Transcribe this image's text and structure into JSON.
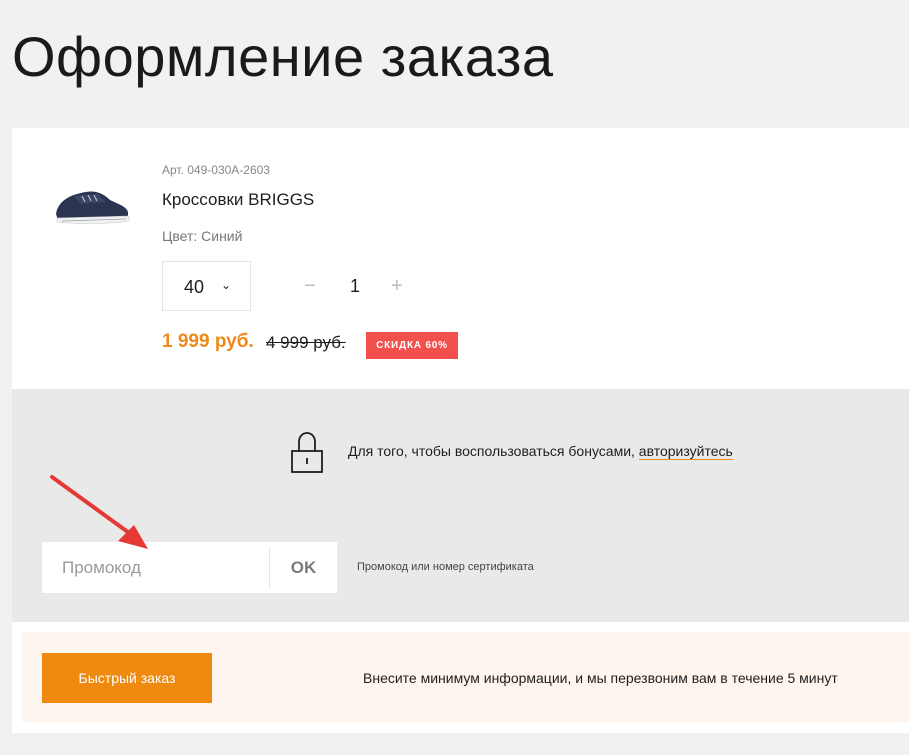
{
  "page": {
    "title": "Оформление заказа"
  },
  "product": {
    "sku": "Арт. 049-030A-2603",
    "name": "Кроссовки BRIGGS",
    "color": "Цвет: Синий",
    "size": "40",
    "quantity": "1",
    "qty_minus": "−",
    "qty_plus": "+",
    "size_chevron": "⌄",
    "price": "1 999 руб.",
    "old_price": "4 999 руб.",
    "discount": "СКИДКА 60%"
  },
  "bonus": {
    "text": "Для того, чтобы воспользоваться бонусами, ",
    "link": "авторизуйтесь"
  },
  "promo": {
    "placeholder": "Промокод",
    "ok_label": "OK",
    "hint": "Промокод или номер сертификата"
  },
  "quick_order": {
    "button_label": "Быстрый заказ",
    "text": "Внесите минимум информации, и мы перезвоним вам в течение 5 минут"
  },
  "colors": {
    "accent": "#ef8a11",
    "discount": "#f2504d",
    "annotation_arrow": "#e53935"
  },
  "icons": [
    "sneaker-image",
    "chevron-down-icon",
    "lock-icon",
    "arrow-annotation"
  ]
}
